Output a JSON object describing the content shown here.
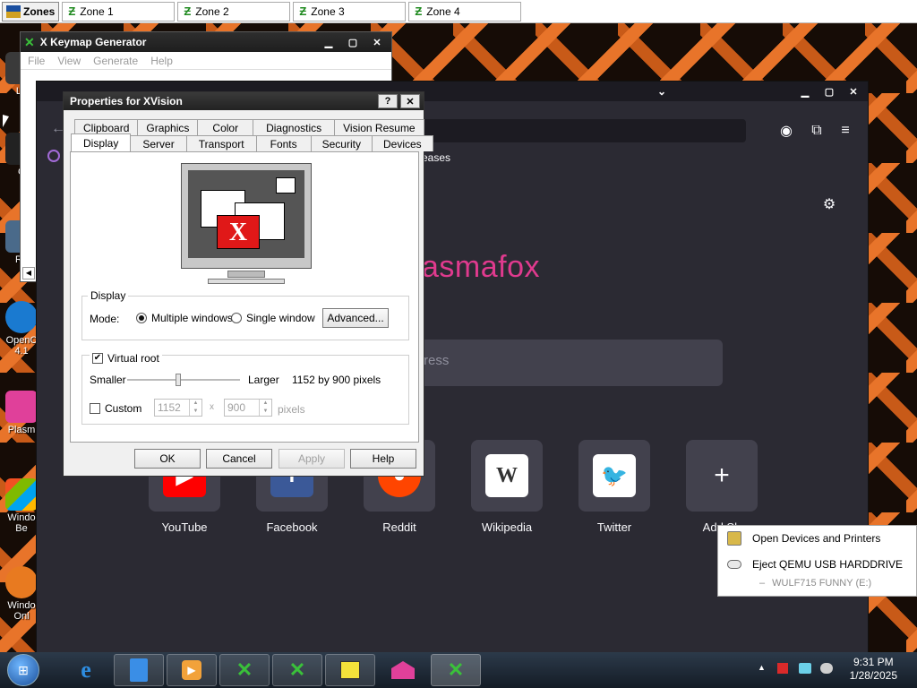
{
  "zones_bar": {
    "zones_label": "Zones",
    "zones": [
      "Zone 1",
      "Zone 2",
      "Zone 3",
      "Zone 4"
    ]
  },
  "desktop_icons": [
    {
      "label": "Lu",
      "icon": "app-icon"
    },
    {
      "label": "C",
      "icon": "app-icon"
    },
    {
      "label": "Re",
      "icon": "recycle-bin-icon"
    },
    {
      "label": "OpenC 4.1",
      "icon": "openc-icon"
    },
    {
      "label": "Plasm",
      "icon": "plasma-icon"
    },
    {
      "label": "Windo Be",
      "icon": "windows-icon"
    },
    {
      "label": "Windo Onl",
      "icon": "windows-icon"
    }
  ],
  "keymap_window": {
    "title": "X Keymap Generator",
    "menu": [
      "File",
      "View",
      "Generate",
      "Help"
    ]
  },
  "browser": {
    "bookmark_fragment": "eases",
    "brand_fragment": "asmafox",
    "search_fragment": "ress",
    "tiles": [
      {
        "label": "YouTube",
        "color": "#ff0000",
        "glyph": "▶"
      },
      {
        "label": "Facebook",
        "color": "#3b5998",
        "glyph": "f"
      },
      {
        "label": "Reddit",
        "color": "#ff4500",
        "glyph": "●"
      },
      {
        "label": "Wikipedia",
        "color": "#ffffff",
        "glyph": "W"
      },
      {
        "label": "Twitter",
        "color": "#1da1f2",
        "glyph": "🐦"
      },
      {
        "label": "Add Sh",
        "color": "",
        "glyph": "+"
      }
    ]
  },
  "props_dialog": {
    "title": "Properties for XVision",
    "help_btn": "?",
    "close_btn": "✕",
    "tabs_row1": [
      "Clipboard",
      "Graphics",
      "Color",
      "Diagnostics",
      "Vision Resume"
    ],
    "tabs_row2": [
      "Display",
      "Server",
      "Transport",
      "Fonts",
      "Security",
      "Devices"
    ],
    "display_group": {
      "label": "Display",
      "mode_label": "Mode:",
      "opt_multiple": "Multiple windows",
      "opt_single": "Single window",
      "advanced_btn": "Advanced..."
    },
    "virtual_root": {
      "label": "Virtual root",
      "checked": true,
      "smaller": "Smaller",
      "larger": "Larger",
      "resolution": "1152 by 900 pixels",
      "slider_level": 0.45,
      "custom_label": "Custom",
      "custom_w": "1152",
      "custom_h": "900",
      "times": "x",
      "pixels": "pixels"
    },
    "buttons": {
      "ok": "OK",
      "cancel": "Cancel",
      "apply": "Apply",
      "help": "Help"
    }
  },
  "tray_popup": {
    "open_devices": "Open Devices and Printers",
    "eject": "Eject QEMU USB HARDDRIVE",
    "drive": "WULF715 FUNNY (E:)"
  },
  "taskbar": {
    "time": "9:31 PM",
    "date": "1/28/2025",
    "apps": [
      "start-orb-icon",
      "ie-icon",
      "files-icon",
      "media-player-icon",
      "xvision-icon",
      "xvision-font-icon",
      "editor-icon",
      "plasma-icon",
      "xvision-active-icon"
    ]
  }
}
